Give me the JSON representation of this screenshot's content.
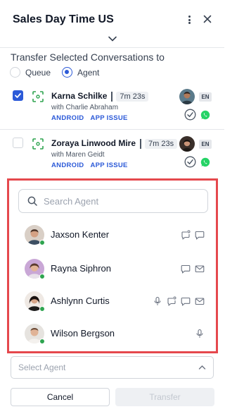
{
  "header": {
    "title": "Sales Day Time US"
  },
  "transfer": {
    "title": "Transfer Selected Conversations to",
    "options": [
      {
        "label": "Queue",
        "selected": false
      },
      {
        "label": "Agent",
        "selected": true
      }
    ]
  },
  "conversations": [
    {
      "name": "Karna Schilke",
      "wait": "7m 23s",
      "with": "with Charlie Abraham",
      "tags": [
        "ANDROID",
        "APP ISSUE"
      ],
      "lang": "EN",
      "checked": true
    },
    {
      "name": "Zoraya Linwood Mire",
      "wait": "7m 23s",
      "with": "with Maren Geidt",
      "tags": [
        "ANDROID",
        "APP ISSUE"
      ],
      "lang": "EN",
      "checked": false
    }
  ],
  "agent_picker": {
    "search_placeholder": "Search Agent",
    "agents": [
      {
        "name": "Jaxson Kenter",
        "status": "online",
        "channels": [
          "chat-bubble-dot-icon",
          "chat-icon"
        ]
      },
      {
        "name": "Rayna Siphron",
        "status": "online",
        "channels": [
          "chat-icon",
          "mail-icon"
        ]
      },
      {
        "name": "Ashlynn Curtis",
        "status": "online",
        "channels": [
          "mic-icon",
          "chat-bubble-dot-icon",
          "chat-icon",
          "mail-icon"
        ]
      },
      {
        "name": "Wilson Bergson",
        "status": "online",
        "channels": [
          "mic-icon"
        ]
      }
    ]
  },
  "select": {
    "placeholder": "Select Agent"
  },
  "footer": {
    "cancel_label": "Cancel",
    "transfer_label": "Transfer"
  },
  "colors": {
    "accent": "#2c5ad8",
    "online": "#2ea44f",
    "highlight_border": "#e5484d",
    "whatsapp": "#25d366"
  }
}
